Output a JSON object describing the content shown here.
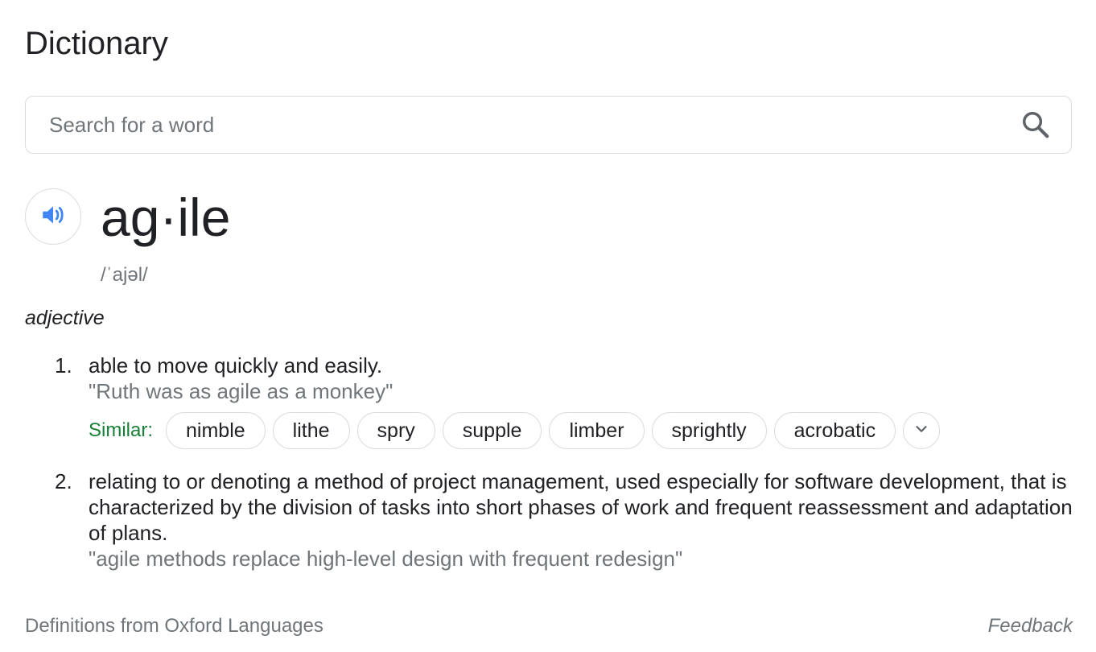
{
  "header": {
    "title": "Dictionary"
  },
  "search": {
    "placeholder": "Search for a word",
    "value": ""
  },
  "entry": {
    "headword": "ag·ile",
    "phonetic": "/ˈajəl/",
    "part_of_speech": "adjective",
    "senses": [
      {
        "number": "1.",
        "definition": "able to move quickly and easily.",
        "example": "\"Ruth was as agile as a monkey\"",
        "similar_label": "Similar:",
        "similar": [
          "nimble",
          "lithe",
          "spry",
          "supple",
          "limber",
          "sprightly",
          "acrobatic"
        ]
      },
      {
        "number": "2.",
        "definition": "relating to or denoting a method of project management, used especially for software development, that is characterized by the division of tasks into short phases of work and frequent reassessment and adaptation of plans.",
        "example": "\"agile methods replace high-level design with frequent redesign\""
      }
    ]
  },
  "footer": {
    "source": "Definitions from Oxford Languages",
    "feedback": "Feedback"
  },
  "icons": {
    "search": "search-icon",
    "speaker": "speaker-icon",
    "expand": "chevron-down-icon"
  },
  "colors": {
    "speaker_blue": "#4285f4",
    "similar_green": "#188038",
    "muted_text": "#70757a"
  }
}
